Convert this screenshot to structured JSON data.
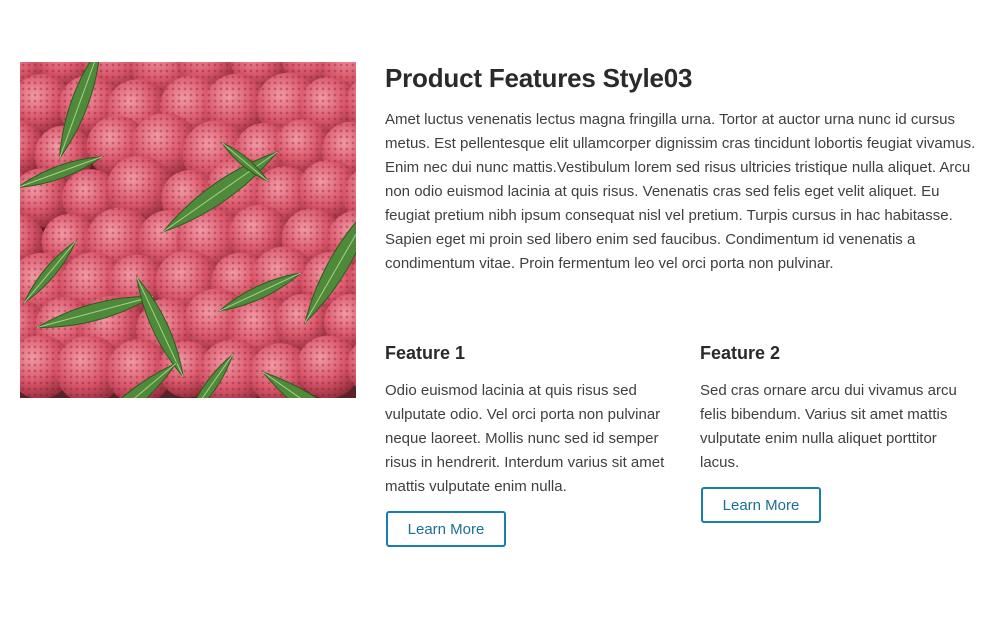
{
  "section": {
    "title": "Product Features Style03",
    "intro": "Amet luctus venenatis lectus magna fringilla urna. Tortor at auctor urna nunc id cursus metus. Est pellentesque elit ullamcorper dignissim cras tincidunt lobortis feugiat vivamus. Enim nec dui nunc mattis.Vestibulum lorem sed risus ultricies tristique nulla aliquet. Arcu non odio euismod lacinia at quis risus. Venenatis cras sed felis eget velit aliquet. Eu feugiat pretium nibh ipsum consequat nisl vel pretium. Turpis cursus in hac habitasse. Sapien eget mi proin sed libero enim sed faucibus. Condimentum id venenatis a condimentum vitae. Proin fermentum leo vel orci porta non pulvinar."
  },
  "image": {
    "subject": "lychee fruits with green leaves"
  },
  "features": [
    {
      "title": "Feature 1",
      "text": "Odio euismod lacinia at quis risus sed vulputate odio. Vel orci porta non pulvinar neque laoreet. Mollis nunc sed id semper risus in hendrerit. Interdum varius sit amet mattis vulputate enim nulla.",
      "button_label": "Learn More"
    },
    {
      "title": "Feature 2",
      "text": "Sed cras ornare arcu dui vivamus arcu felis bibendum. Varius sit amet mattis vulputate enim nulla aliquet porttitor lacus.",
      "button_label": "Learn More"
    }
  ],
  "colors": {
    "accent": "#1a7fa8",
    "title_text": "#2a2a2a",
    "body_text": "#3f3f3f",
    "fruit": "#d9566a",
    "leaf": "#4f8a3a"
  }
}
